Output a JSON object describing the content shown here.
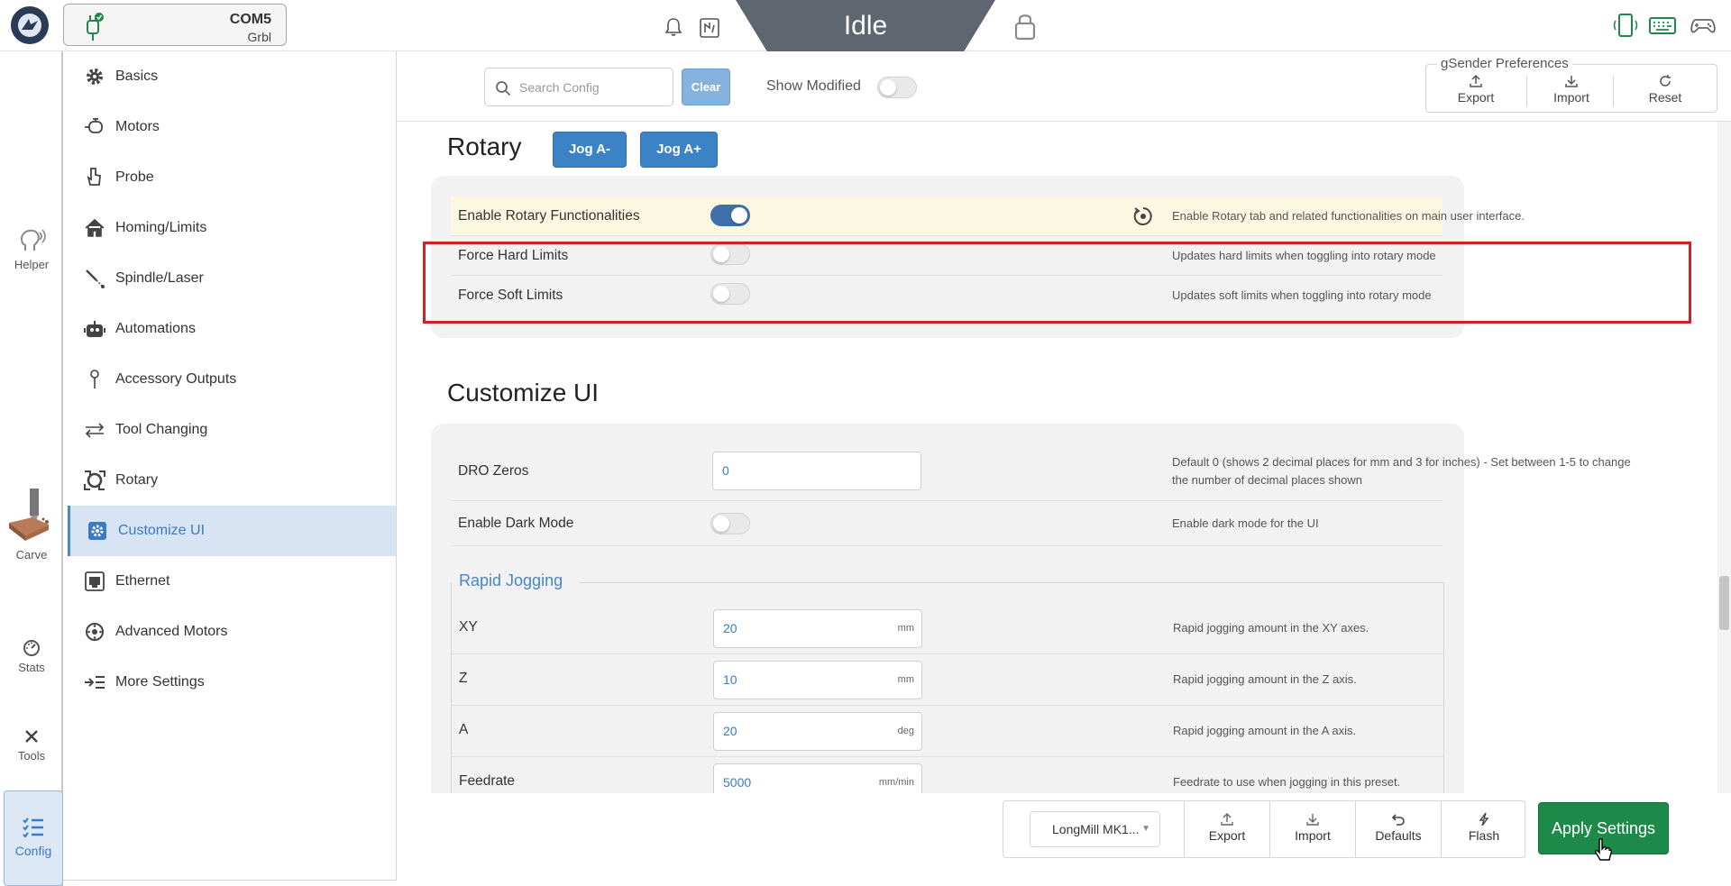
{
  "topbar": {
    "port": "COM5",
    "firmware": "Grbl",
    "state": "Idle"
  },
  "rail": {
    "items": [
      {
        "label": "Helper",
        "icon": "helper-icon"
      },
      {
        "label": "Carve",
        "icon": "carve-icon"
      },
      {
        "label": "Stats",
        "icon": "stats-icon"
      },
      {
        "label": "Tools",
        "icon": "tools-icon"
      },
      {
        "label": "Config",
        "icon": "config-icon"
      }
    ]
  },
  "sidebar": {
    "items": [
      {
        "label": "Basics",
        "icon": "gear-icon"
      },
      {
        "label": "Motors",
        "icon": "motor-icon"
      },
      {
        "label": "Probe",
        "icon": "probe-icon"
      },
      {
        "label": "Homing/Limits",
        "icon": "home-icon"
      },
      {
        "label": "Spindle/Laser",
        "icon": "spindle-icon"
      },
      {
        "label": "Automations",
        "icon": "robot-icon"
      },
      {
        "label": "Accessory Outputs",
        "icon": "pin-icon"
      },
      {
        "label": "Tool Changing",
        "icon": "swap-icon"
      },
      {
        "label": "Rotary",
        "icon": "rotary-icon"
      },
      {
        "label": "Customize UI",
        "icon": "customize-icon"
      },
      {
        "label": "Ethernet",
        "icon": "ethernet-icon"
      },
      {
        "label": "Advanced Motors",
        "icon": "advanced-motor-icon"
      },
      {
        "label": "More Settings",
        "icon": "more-settings-icon"
      }
    ],
    "active": "Customize UI"
  },
  "header": {
    "search_placeholder": "Search Config",
    "clear_label": "Clear",
    "show_modified_label": "Show Modified",
    "show_modified": false,
    "prefs_title": "gSender Preferences",
    "export_label": "Export",
    "import_label": "Import",
    "reset_label": "Reset"
  },
  "rotary": {
    "title": "Rotary",
    "jog_minus": "Jog A-",
    "jog_plus": "Jog A+",
    "rows": [
      {
        "name": "Enable Rotary Functionalities",
        "enabled": true,
        "desc": "Enable Rotary tab and related functionalities on main user interface."
      },
      {
        "name": "Force Hard Limits",
        "enabled": false,
        "desc": "Updates hard limits when toggling into rotary mode"
      },
      {
        "name": "Force Soft Limits",
        "enabled": false,
        "desc": "Updates soft limits when toggling into rotary mode"
      }
    ]
  },
  "customize": {
    "title": "Customize UI",
    "dro_zeros": {
      "name": "DRO Zeros",
      "value": "0",
      "desc": "Default 0 (shows 2 decimal places for mm and 3 for inches) - Set between 1-5 to change the number of decimal places shown"
    },
    "dark_mode": {
      "name": "Enable Dark Mode",
      "enabled": false,
      "desc": "Enable dark mode for the UI"
    },
    "rapid_title": "Rapid Jogging",
    "rapid_rows": [
      {
        "name": "XY",
        "value": "20",
        "unit": "mm",
        "desc": "Rapid jogging amount in the XY axes."
      },
      {
        "name": "Z",
        "value": "10",
        "unit": "mm",
        "desc": "Rapid jogging amount in the Z axis."
      },
      {
        "name": "A",
        "value": "20",
        "unit": "deg",
        "desc": "Rapid jogging amount in the A axis."
      },
      {
        "name": "Feedrate",
        "value": "5000",
        "unit": "mm/min",
        "desc": "Feedrate to use when jogging in this preset."
      }
    ]
  },
  "footer": {
    "machine": "LongMill MK1...",
    "export_label": "Export",
    "import_label": "Import",
    "defaults_label": "Defaults",
    "flash_label": "Flash",
    "apply_label": "Apply Settings"
  },
  "colors": {
    "accent": "#3c82c6",
    "apply": "#1d8a4a",
    "highlight": "#cc2229",
    "state_bg": "#5f6670"
  }
}
